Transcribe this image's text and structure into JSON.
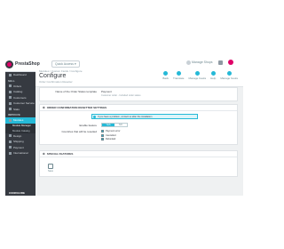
{
  "topbar": {
    "logo": "PrestaShop",
    "quick_access": "Quick Access",
    "links": [
      {
        "label": "Manage Shops"
      },
      {
        "label": "Help"
      },
      {
        "label": "Customers"
      }
    ]
  },
  "sidebar": {
    "items": [
      {
        "label": "Dashboard"
      },
      {
        "label": "SELL",
        "head": true
      },
      {
        "label": "Orders"
      },
      {
        "label": "Catalog"
      },
      {
        "label": "Customers"
      },
      {
        "label": "Customer Service"
      },
      {
        "label": "Stats"
      },
      {
        "label": "IMPROVE",
        "head": true
      },
      {
        "label": "Modules",
        "active": true
      }
    ],
    "subitems": [
      {
        "label": "Module Manager",
        "on": true
      },
      {
        "label": "Module Catalog"
      }
    ],
    "more": [
      {
        "label": "Design"
      },
      {
        "label": "Shipping"
      },
      {
        "label": "Payment"
      },
      {
        "label": "International"
      }
    ],
    "footer": "CONFIGURE"
  },
  "header": {
    "breadcrumb": "Modules / Custom Fields / Configure",
    "title": "Configure",
    "subtitle": "Order Confirmation Resetter",
    "toolbar": [
      {
        "label": "Back"
      },
      {
        "label": "Translate"
      },
      {
        "label": "Manage hooks"
      },
      {
        "label": "Help"
      },
      {
        "label": "Manage hooks"
      }
    ]
  },
  "panel1": {
    "label": "Name of the Order Status template",
    "value": "Payment",
    "help": "Customer order - Included order status"
  },
  "panel2": {
    "title": "ORDER CONFIRMATION RESETTER SETTINGS",
    "alert": "If you have a problem, contact us after the installation",
    "enable_label": "Enable feature",
    "yes": "YES",
    "no": "NO",
    "checkbox_label": "Countries that will be resetted",
    "checkboxes": [
      "Payment error",
      "Cancelled",
      "Refunded"
    ]
  },
  "panel3": {
    "title": "SPECIAL FEATURES",
    "save": "Save"
  },
  "colors": {
    "accent": "#25b9d7",
    "sidebar": "#363a41",
    "brand": "#df0067"
  }
}
